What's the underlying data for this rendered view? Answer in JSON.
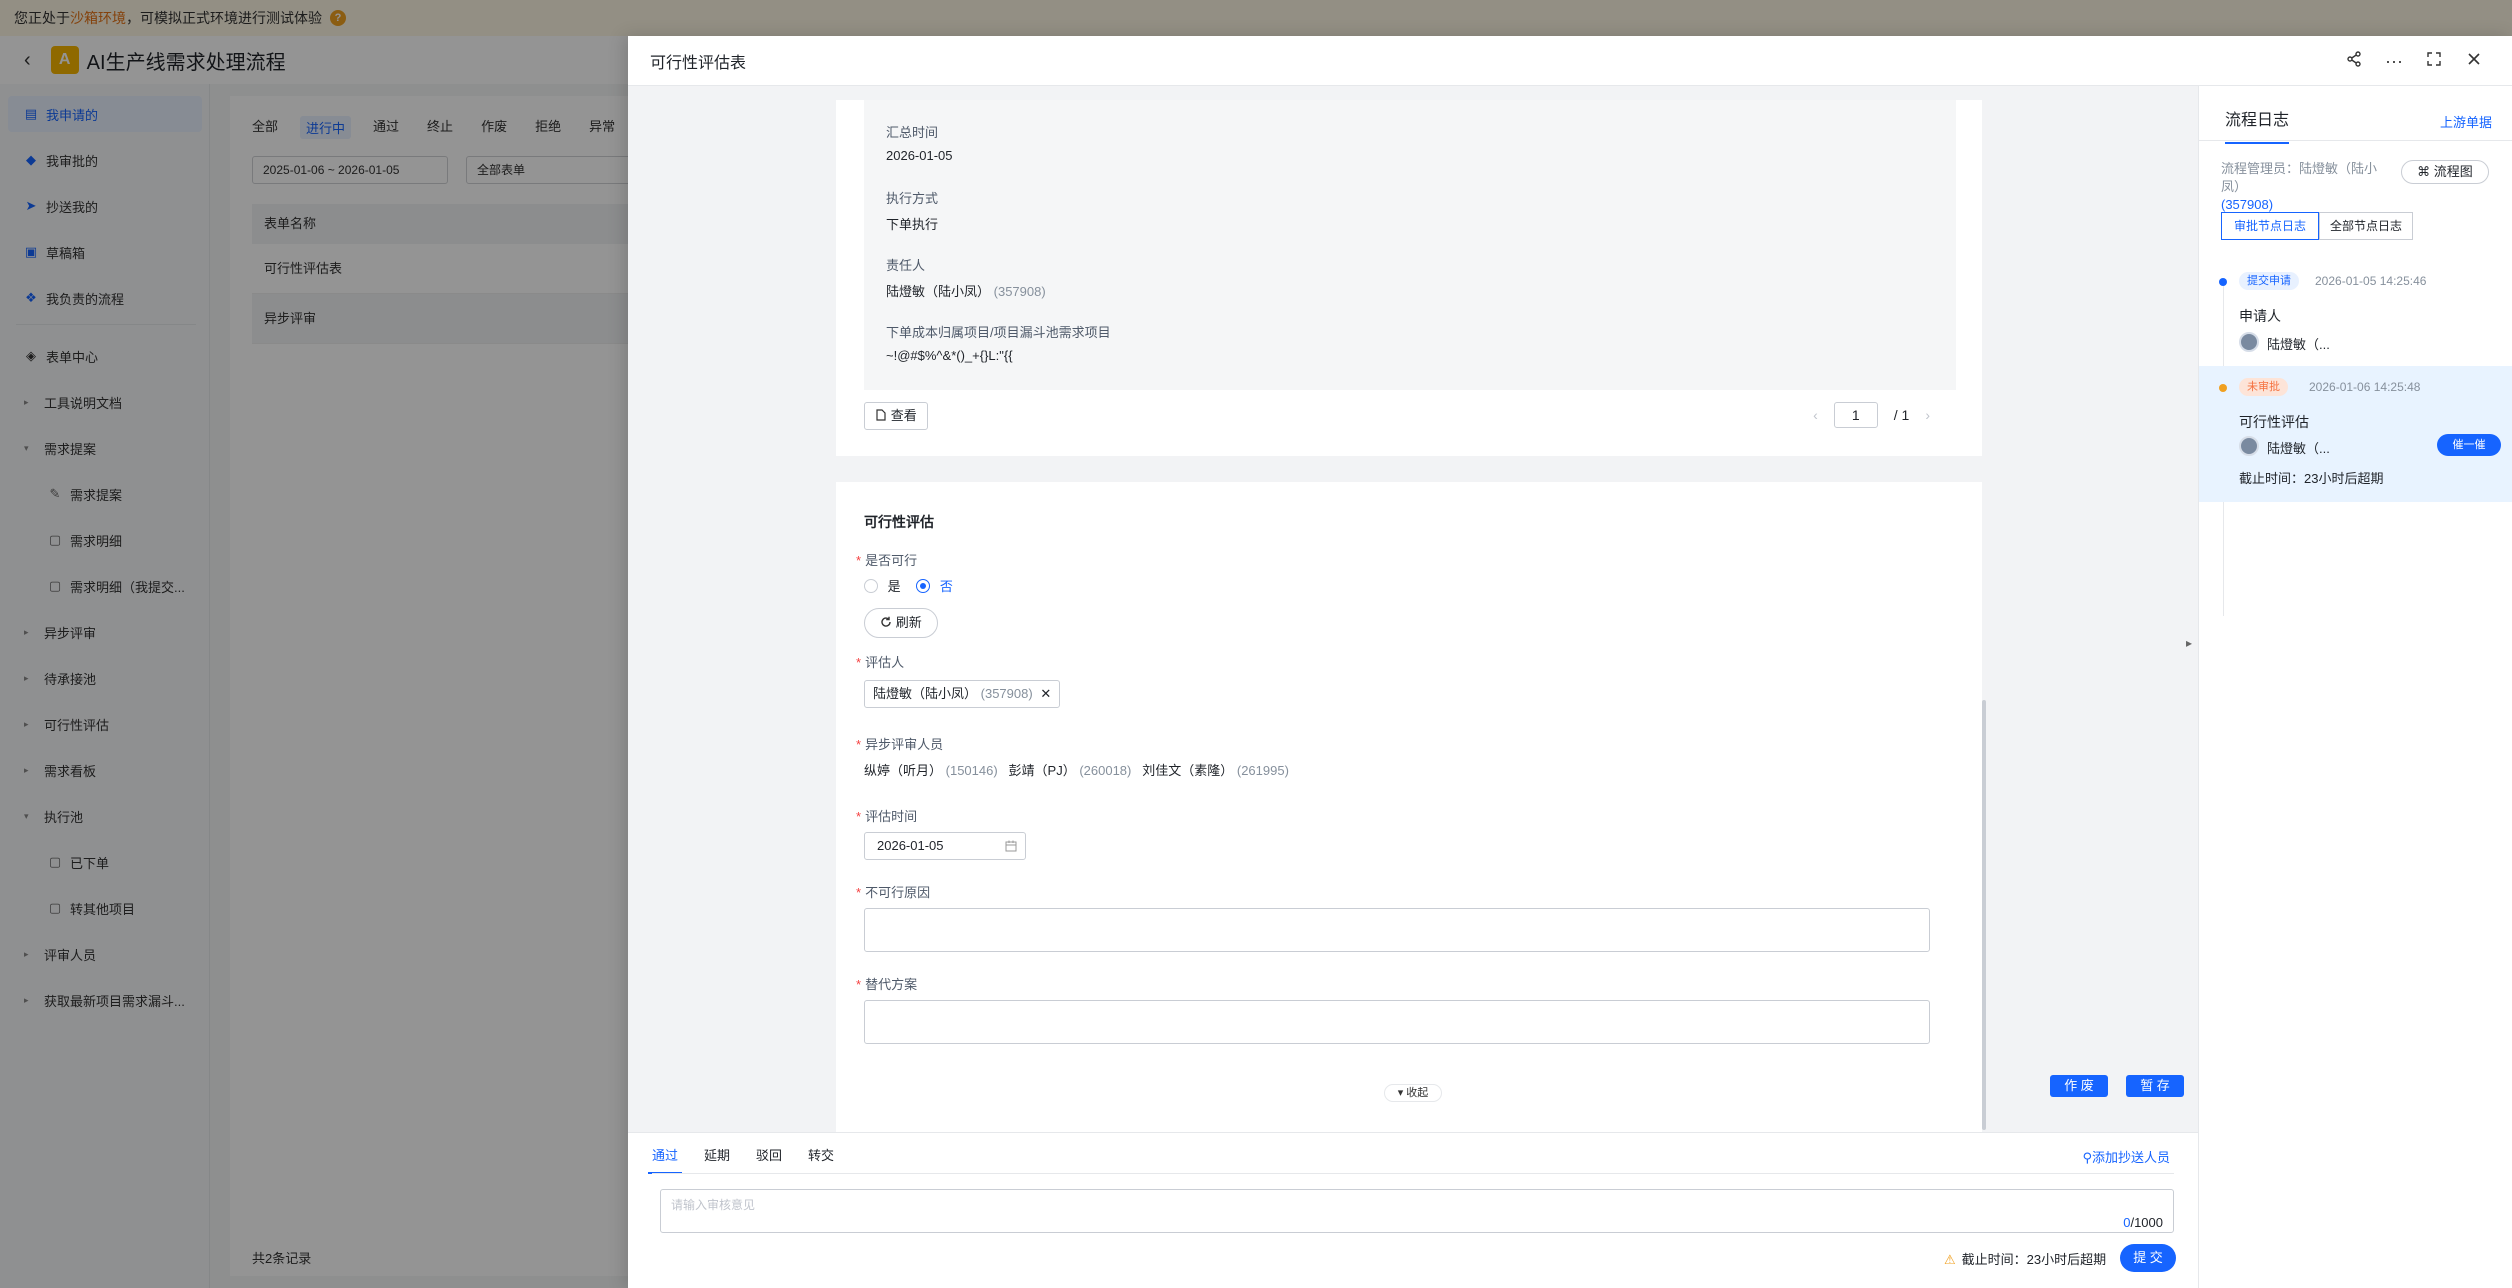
{
  "banner": {
    "text_pre": "您正处于",
    "text_hl": "沙箱环境",
    "text_post": "，可模拟正式环境进行测试体验",
    "help": "?"
  },
  "app": {
    "back_icon": "‹",
    "logo_letter": "A",
    "title": "AI生产线需求处理流程"
  },
  "sidebar": {
    "items": [
      {
        "label": "我申请的",
        "icon": "▤",
        "active": true
      },
      {
        "label": "我审批的",
        "icon": "◆"
      },
      {
        "label": "抄送我的",
        "icon": "➤"
      },
      {
        "label": "草稿箱",
        "icon": "▣"
      },
      {
        "label": "我负责的流程",
        "icon": "❖"
      },
      {
        "label": "表单中心",
        "icon": "◈"
      },
      {
        "label": "工具说明文档",
        "arrow": "▸"
      },
      {
        "label": "需求提案",
        "arrow": "▾"
      },
      {
        "label": "需求提案",
        "sub": true,
        "icon": "✎"
      },
      {
        "label": "需求明细",
        "sub": true,
        "icon": "▢"
      },
      {
        "label": "需求明细（我提交...",
        "sub": true,
        "icon": "▢"
      },
      {
        "label": "异步评审",
        "arrow": "▸"
      },
      {
        "label": "待承接池",
        "arrow": "▸"
      },
      {
        "label": "可行性评估",
        "arrow": "▸"
      },
      {
        "label": "需求看板",
        "arrow": "▸"
      },
      {
        "label": "执行池",
        "arrow": "▾"
      },
      {
        "label": "已下单",
        "sub": true,
        "icon": "▢"
      },
      {
        "label": "转其他项目",
        "sub": true,
        "icon": "▢"
      },
      {
        "label": "评审人员",
        "arrow": "▸"
      },
      {
        "label": "获取最新项目需求漏斗...",
        "arrow": "▸"
      }
    ]
  },
  "list": {
    "tabs": [
      "全部",
      "进行中",
      "通过",
      "终止",
      "作废",
      "拒绝",
      "异常"
    ],
    "date_range": "2025-01-06 ~ 2026-01-05",
    "form_select": "全部表单",
    "column": "表单名称",
    "rows": [
      "可行性评估表",
      "异步评审"
    ],
    "count": "共2条记录"
  },
  "drawer": {
    "title": "可行性评估表",
    "icons": {
      "share": "share-icon",
      "more": "more-icon",
      "expand": "expand-icon",
      "close": "close-icon"
    },
    "summary": {
      "f1_label": "汇总时间",
      "f1_value": "2026-01-05",
      "f2_label": "执行方式",
      "f2_value": "下单执行",
      "f3_label": "责任人",
      "f3_name": "陆燈敏（陆小凤）",
      "f3_id": "(357908)",
      "f4_label": "下单成本归属项目/项目漏斗池需求项目",
      "f4_value": "~!@#$%^&*()_+{}L:\"{{"
    },
    "view_btn": "查看",
    "pager": {
      "page": "1",
      "total": "/ 1"
    },
    "section_title": "可行性评估",
    "feasible": {
      "label": "是否可行",
      "opt_yes": "是",
      "opt_no": "否",
      "selected": "否"
    },
    "refresh_btn": "刷新",
    "assessor": {
      "label": "评估人",
      "name": "陆燈敏（陆小凤）",
      "id": "(357908)"
    },
    "async_reviewers": {
      "label": "异步评审人员",
      "people": [
        {
          "name": "纵婷（听月）",
          "id": "(150146)"
        },
        {
          "name": "彭靖（PJ）",
          "id": "(260018)"
        },
        {
          "name": "刘佳文（素隆）",
          "id": "(261995)"
        }
      ]
    },
    "assess_time": {
      "label": "评估时间",
      "value": "2026-01-05"
    },
    "not_feasible_reason": {
      "label": "不可行原因"
    },
    "alternative": {
      "label": "替代方案"
    },
    "collapse": "▾ 收起",
    "void_btn": "作 废",
    "save_btn": "暂 存",
    "bottom": {
      "tabs": [
        "通过",
        "延期",
        "驳回",
        "转交"
      ],
      "active_tab": "通过",
      "add_cc": "添加抄送人员",
      "comment_placeholder": "请输入审核意见",
      "count_cur": "0",
      "count_max": "/1000",
      "deadline": "截止时间：23小时后超期",
      "submit": "提 交"
    },
    "log": {
      "title": "流程日志",
      "upstream": "上游单据",
      "manager_label": "流程管理员：陆燈敏（陆小凤）",
      "manager_id": "(357908)",
      "flow_btn": "流程图",
      "seg_approval": "审批节点日志",
      "seg_all": "全部节点日志",
      "entries": [
        {
          "badge": "提交申请",
          "time": "2026-01-05 14:25:46",
          "node": "申请人",
          "person": "陆燈敏（..."
        },
        {
          "badge": "未审批",
          "time": "2026-01-06 14:25:48",
          "node": "可行性评估",
          "person": "陆燈敏（...",
          "urge": "催一催",
          "deadline": "截止时间：23小时后超期"
        }
      ]
    }
  },
  "colors": {
    "primary": "#1664ff",
    "danger": "#f53f3f",
    "warning": "#f0a020"
  }
}
